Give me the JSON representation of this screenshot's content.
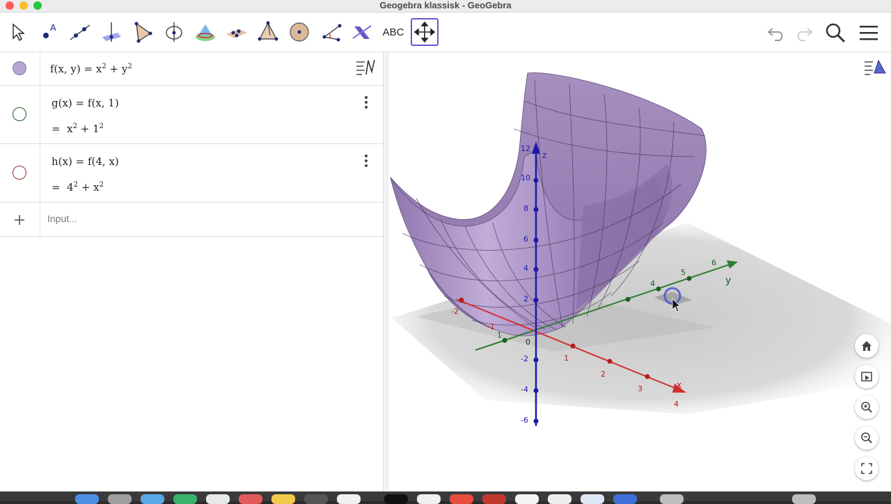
{
  "window": {
    "title": "Geogebra klassisk - GeoGebra"
  },
  "toolbar": {
    "tools": [
      {
        "name": "move-tool"
      },
      {
        "name": "point-tool",
        "label": "A"
      },
      {
        "name": "line-tool"
      },
      {
        "name": "perpendicular-tool"
      },
      {
        "name": "polygon-tool"
      },
      {
        "name": "circle-axis-tool"
      },
      {
        "name": "intersect-surfaces-tool"
      },
      {
        "name": "plane-tool"
      },
      {
        "name": "pyramid-tool"
      },
      {
        "name": "sphere-tool"
      },
      {
        "name": "angle-tool"
      },
      {
        "name": "reflect-tool"
      },
      {
        "name": "text-tool",
        "label": "ABC"
      },
      {
        "name": "move-graphics-view-tool",
        "active": true
      }
    ]
  },
  "algebra": {
    "rows": [
      {
        "color": "#b7a6cf",
        "filled": true,
        "lhs": "f(x, y)",
        "eq": "=",
        "rhs_parts": [
          "x",
          "2",
          " + y",
          "2"
        ]
      },
      {
        "color": "#1f5c1f",
        "filled": false,
        "lhs": "g(x)",
        "eq": "=",
        "def": "f(x, 1)",
        "value_parts": [
          "x",
          "2",
          " + 1",
          "2"
        ]
      },
      {
        "color": "#9a2b2b",
        "filled": false,
        "lhs": "h(x)",
        "eq": "=",
        "def": "f(4, x)",
        "value_parts": [
          "4",
          "2",
          " + x",
          "2"
        ]
      }
    ],
    "input_placeholder": "Input..."
  },
  "view3d": {
    "z_ticks": [
      "12",
      "10",
      "8",
      "6",
      "4",
      "2",
      "0",
      "-2",
      "-4",
      "-6"
    ],
    "x_ticks": [
      "-2",
      "-1",
      "1",
      "2",
      "3",
      "4"
    ],
    "y_ticks": [
      "1",
      "4",
      "5",
      "6"
    ],
    "labels": {
      "z": "z",
      "y": "y",
      "x": "x"
    },
    "colors": {
      "surface": "#9c83b8",
      "x_axis": "#d32f2f",
      "y_axis": "#2e7d32",
      "z_axis": "#1a1aa6"
    }
  }
}
